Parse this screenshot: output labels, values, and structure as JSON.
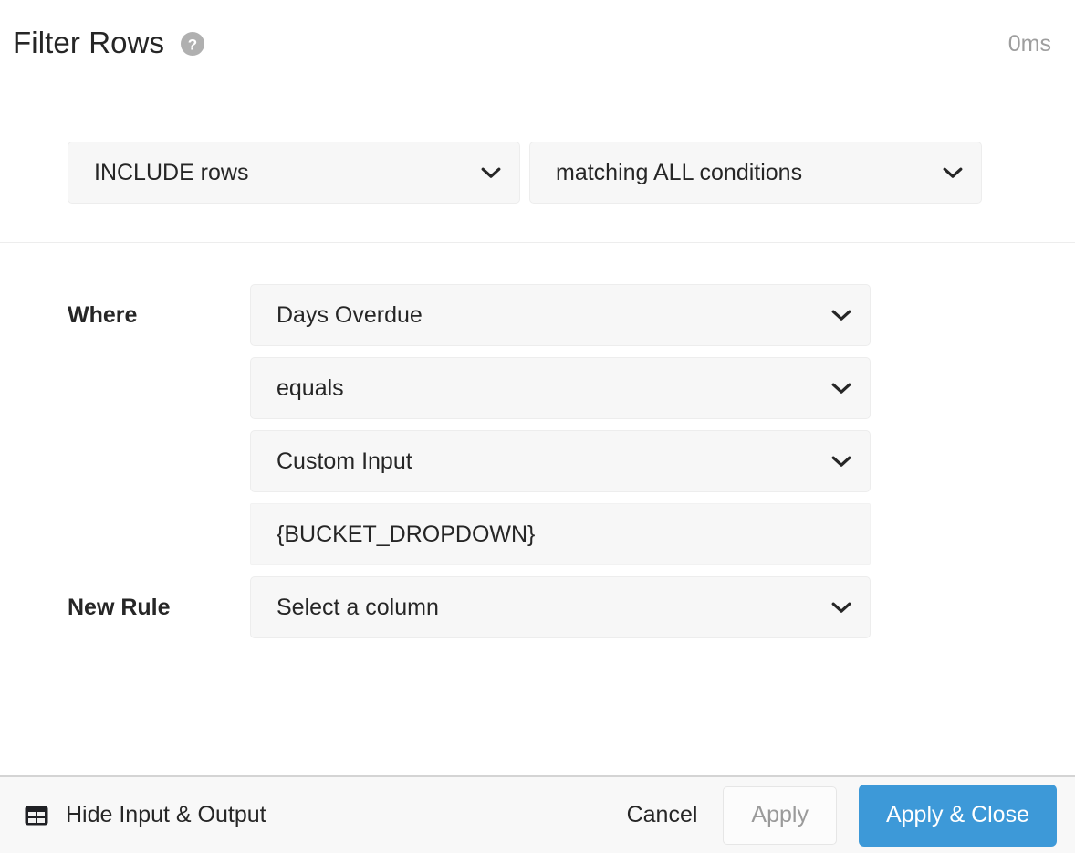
{
  "header": {
    "title": "Filter Rows",
    "help_icon": "help-circle-icon",
    "timing": "0ms"
  },
  "mode": {
    "include_mode": "INCLUDE rows",
    "match_mode": "matching ALL conditions"
  },
  "rules": [
    {
      "label": "Where",
      "column": "Days Overdue",
      "operator": "equals",
      "value_type": "Custom Input",
      "value": "{BUCKET_DROPDOWN}"
    }
  ],
  "new_rule": {
    "label": "New Rule",
    "placeholder_value": "Select a column"
  },
  "footer": {
    "toggle_io_icon": "table-icon",
    "toggle_io_label": "Hide Input & Output",
    "cancel_label": "Cancel",
    "apply_label": "Apply",
    "apply_close_label": "Apply & Close"
  },
  "colors": {
    "primary": "#3d99d8",
    "field_bg": "#f7f7f7",
    "footer_bg": "#f8f8f8",
    "muted_text": "#9e9e9e"
  }
}
